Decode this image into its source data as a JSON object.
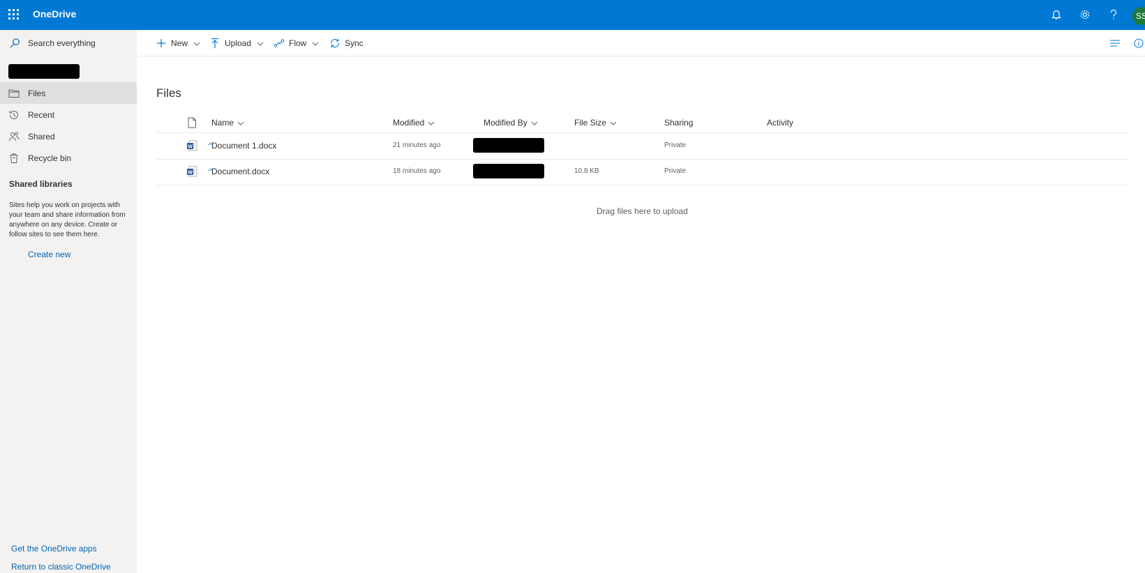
{
  "app": {
    "title": "OneDrive",
    "avatar_initials": "SS"
  },
  "colors": {
    "brand": "#0078d4",
    "link": "#0063b1",
    "sidebar_bg": "#f3f2f1",
    "active_item": "#e1dfdd",
    "word_blue": "#2b579a"
  },
  "sidebar": {
    "search_placeholder": "Search everything",
    "items": [
      {
        "label": "Files",
        "icon": "folder-icon",
        "active": true
      },
      {
        "label": "Recent",
        "icon": "history-icon",
        "active": false
      },
      {
        "label": "Shared",
        "icon": "people-icon",
        "active": false
      },
      {
        "label": "Recycle bin",
        "icon": "recycle-bin-icon",
        "active": false
      }
    ],
    "shared_libraries_title": "Shared libraries",
    "shared_libraries_text": "Sites help you work on projects with your team and share information from anywhere on any device. Create or follow sites to see them here.",
    "create_new": "Create new",
    "get_apps": "Get the OneDrive apps",
    "return_classic": "Return to classic OneDrive"
  },
  "toolbar": {
    "new_label": "New",
    "upload_label": "Upload",
    "flow_label": "Flow",
    "sync_label": "Sync"
  },
  "main": {
    "title": "Files",
    "columns": {
      "name": "Name",
      "modified": "Modified",
      "modified_by": "Modified By",
      "file_size": "File Size",
      "sharing": "Sharing",
      "activity": "Activity"
    },
    "files": [
      {
        "name": "Document 1.docx",
        "modified": "21 minutes ago",
        "file_size": "",
        "sharing": "Private"
      },
      {
        "name": "Document.docx",
        "modified": "18 minutes ago",
        "file_size": "10.8 KB",
        "sharing": "Private"
      }
    ],
    "drop_hint": "Drag files here to upload"
  }
}
